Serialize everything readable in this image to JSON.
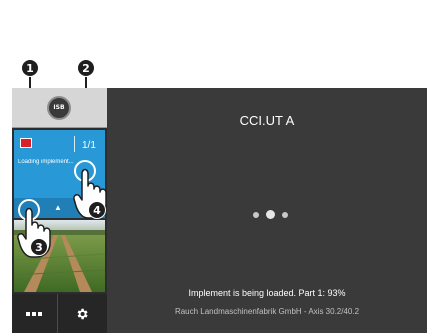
{
  "callouts": {
    "one": "1",
    "two": "2",
    "three": "3",
    "four": "4"
  },
  "sidebar": {
    "isb_label": "ISB",
    "app": {
      "icon": "implement-app-icon",
      "page_indicator": "1/1",
      "status": "Loading implement..."
    },
    "nav_icon": "caret-up-icon",
    "camera": "field-camera-image",
    "menu_icon": "menu-dots-icon",
    "settings_icon": "gear-icon"
  },
  "main": {
    "title": "CCI.UT A",
    "progress_text": "Implement is being loaded. Part 1: 93%",
    "progress_percent": 93,
    "manufacturer": "Rauch Landmaschinenfabrik GmbH - Axis 30.2/40.2"
  },
  "colors": {
    "terminal_bg": "#3a3a3a",
    "sidebar_bg": "#2d2d2d",
    "app_tile": "#2899d6",
    "app_nav": "#1f7fb6",
    "callout": "#1e1e1e"
  }
}
